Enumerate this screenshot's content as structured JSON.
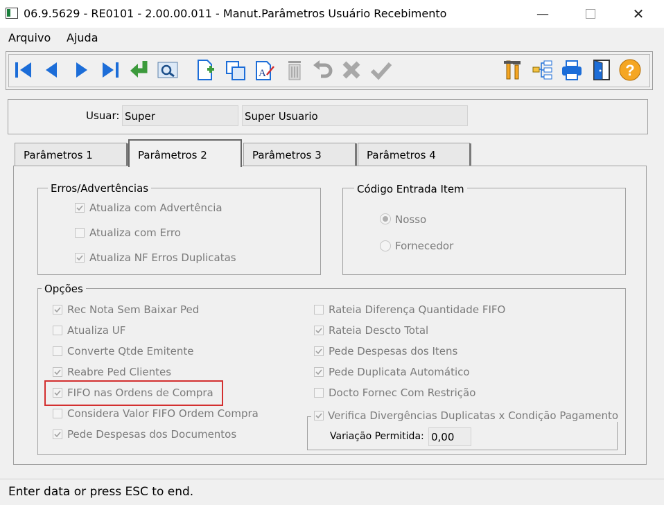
{
  "window": {
    "title": "06.9.5629 - RE0101 - 2.00.00.011 - Manut.Parâmetros Usuário Recebimento",
    "minimize_icon": "minimize-icon",
    "maximize_icon": "maximize-icon",
    "close_icon": "close-icon"
  },
  "menu": [
    "Arquivo",
    "Ajuda"
  ],
  "toolbar": {
    "left": [
      "first-record-icon",
      "prev-record-icon",
      "next-record-icon",
      "last-record-icon",
      "goto-icon",
      "search-icon",
      "new-icon",
      "copy-icon",
      "edit-icon",
      "delete-icon",
      "undo-icon",
      "cancel-icon",
      "confirm-icon"
    ],
    "right": [
      "tools-icon",
      "tree-icon",
      "print-icon",
      "exit-icon",
      "help-icon"
    ],
    "colors": {
      "blue": "#1c6dd8",
      "green": "#4caf50",
      "gray": "#9e9e9e",
      "help": "#f5a623"
    }
  },
  "user": {
    "label": "Usuar:",
    "code": "Super",
    "name": "Super Usuario"
  },
  "tabs": [
    "Parâmetros 1",
    "Parâmetros 2",
    "Parâmetros 3",
    "Parâmetros 4"
  ],
  "active_tab": 1,
  "errors_group": {
    "title": "Erros/Advertências",
    "items": [
      {
        "label": "Atualiza com Advertência",
        "checked": true
      },
      {
        "label": "Atualiza com Erro",
        "checked": false
      },
      {
        "label": "Atualiza NF Erros Duplicatas",
        "checked": true
      }
    ]
  },
  "code_group": {
    "title": "Código Entrada Item",
    "options": [
      {
        "label": "Nosso",
        "selected": true
      },
      {
        "label": "Fornecedor",
        "selected": false
      }
    ]
  },
  "options_group": {
    "title": "Opções",
    "left": [
      {
        "label": "Rec Nota Sem Baixar Ped",
        "checked": true
      },
      {
        "label": "Atualiza UF",
        "checked": false
      },
      {
        "label": "Converte Qtde Emitente",
        "checked": false
      },
      {
        "label": "Reabre Ped Clientes",
        "checked": true
      },
      {
        "label": "FIFO nas Ordens de Compra",
        "checked": true
      },
      {
        "label": "Considera Valor FIFO Ordem Compra",
        "checked": false
      },
      {
        "label": "Pede Despesas dos Documentos",
        "checked": true
      }
    ],
    "right": [
      {
        "label": "Rateia Diferença Quantidade FIFO",
        "checked": false
      },
      {
        "label": "Rateia Descto Total",
        "checked": true
      },
      {
        "label": "Pede Despesas dos Itens",
        "checked": true
      },
      {
        "label": "Pede Duplicata Automático",
        "checked": true
      },
      {
        "label": "Docto Fornec Com Restrição",
        "checked": false
      }
    ],
    "verify": {
      "label": "Verifica Divergências Duplicatas x Condição Pagamento",
      "checked": true,
      "variation_label": "Variação Permitida:",
      "variation_value": "0,00"
    }
  },
  "highlight_color": "#d32f2f",
  "status": "Enter data or press ESC to end."
}
